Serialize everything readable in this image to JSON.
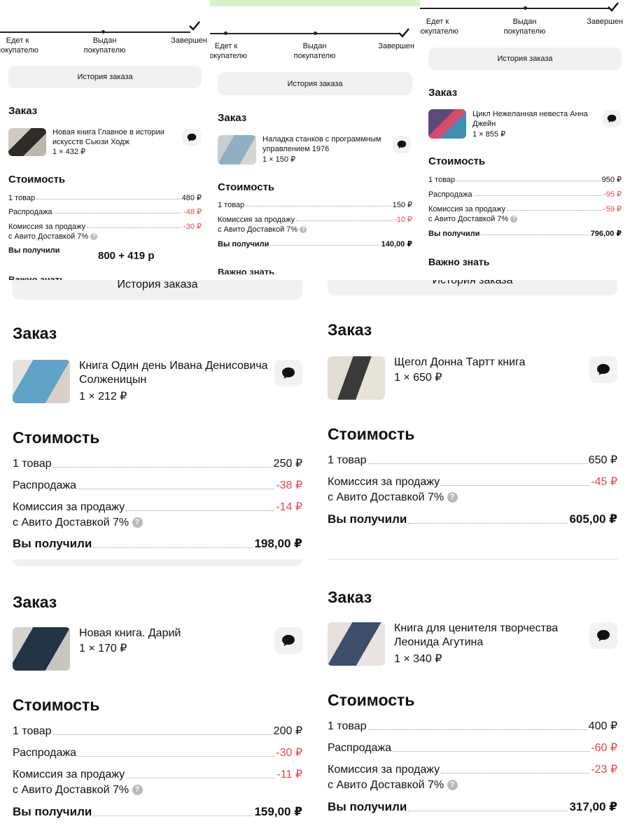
{
  "colors": {
    "accent_negative": "#e0474c",
    "button_bg": "#f1f1f1",
    "text": "#111111"
  },
  "tracker": {
    "step1": "Едет к покупателю",
    "step2": "Выдан покупателю",
    "step3": "Завершен"
  },
  "history_button": "История заказа",
  "order_title": "Заказ",
  "cost_title": "Стоимость",
  "important_title": "Важно знать",
  "labels": {
    "items": "1 товар",
    "sale": "Распродажа",
    "commission_l1": "Комиссия за продажу",
    "commission_l2": "с Авито Доставкой 7%",
    "received": "Вы получили",
    "info_icon": "?"
  },
  "orders": [
    {
      "title": "Новая книга Главное в истории искусств Сьюзи Ходж",
      "qty_price": "1 × 432 ₽",
      "items_value": "480 ₽",
      "sale_value": "-48 ₽",
      "commission_value": "-30 ₽",
      "received_value": "",
      "note": "800 + 419 р",
      "thumb_colors": [
        "#c9c4b8",
        "#2e2c28"
      ]
    },
    {
      "title": "Наладка станков с программным управлением 1976",
      "qty_price": "1 × 150 ₽",
      "items_value": "150 ₽",
      "sale_value": "",
      "commission_value": "-10 ₽",
      "received_value": "140,00 ₽",
      "thumb_colors": [
        "#b9c7cf",
        "#7ea3b5"
      ]
    },
    {
      "title": "Цикл Нежеланная невеста Анна Джейн",
      "qty_price": "1 × 855 ₽",
      "items_value": "950 ₽",
      "sale_value": "-95 ₽",
      "commission_value": "-59 ₽",
      "received_value": "796,00 ₽",
      "thumb_colors": [
        "#5c4a7a",
        "#d84b6e"
      ]
    },
    {
      "title": "Книга Один день Ивана Денисовича Солженицын",
      "qty_price": "1 × 212 ₽",
      "items_value": "250 ₽",
      "sale_value": "-38 ₽",
      "commission_value": "-14 ₽",
      "received_value": "198,00 ₽",
      "thumb_colors": [
        "#d9d6d2",
        "#5fa3c8"
      ]
    },
    {
      "title": "Щегол Донна Тартт книга",
      "qty_price": "1 × 650 ₽",
      "items_value": "650 ₽",
      "sale_value": "",
      "commission_value": "-45 ₽",
      "received_value": "605,00 ₽",
      "thumb_colors": [
        "#d8d3c9",
        "#3a3a3a"
      ]
    },
    {
      "title": "Новая книга. Дарий",
      "qty_price": "1 × 170 ₽",
      "items_value": "200 ₽",
      "sale_value": "-30 ₽",
      "commission_value": "-11 ₽",
      "received_value": "159,00 ₽",
      "thumb_colors": [
        "#c9c6c0",
        "#243447"
      ]
    },
    {
      "title": "Книга для ценителя творчества Леонида Агутина",
      "qty_price": "1 × 340 ₽",
      "items_value": "400 ₽",
      "sale_value": "-60 ₽",
      "commission_value": "-23 ₽",
      "received_value": "317,00 ₽",
      "thumb_colors": [
        "#e6dfdc",
        "#3b4f6b"
      ]
    }
  ]
}
